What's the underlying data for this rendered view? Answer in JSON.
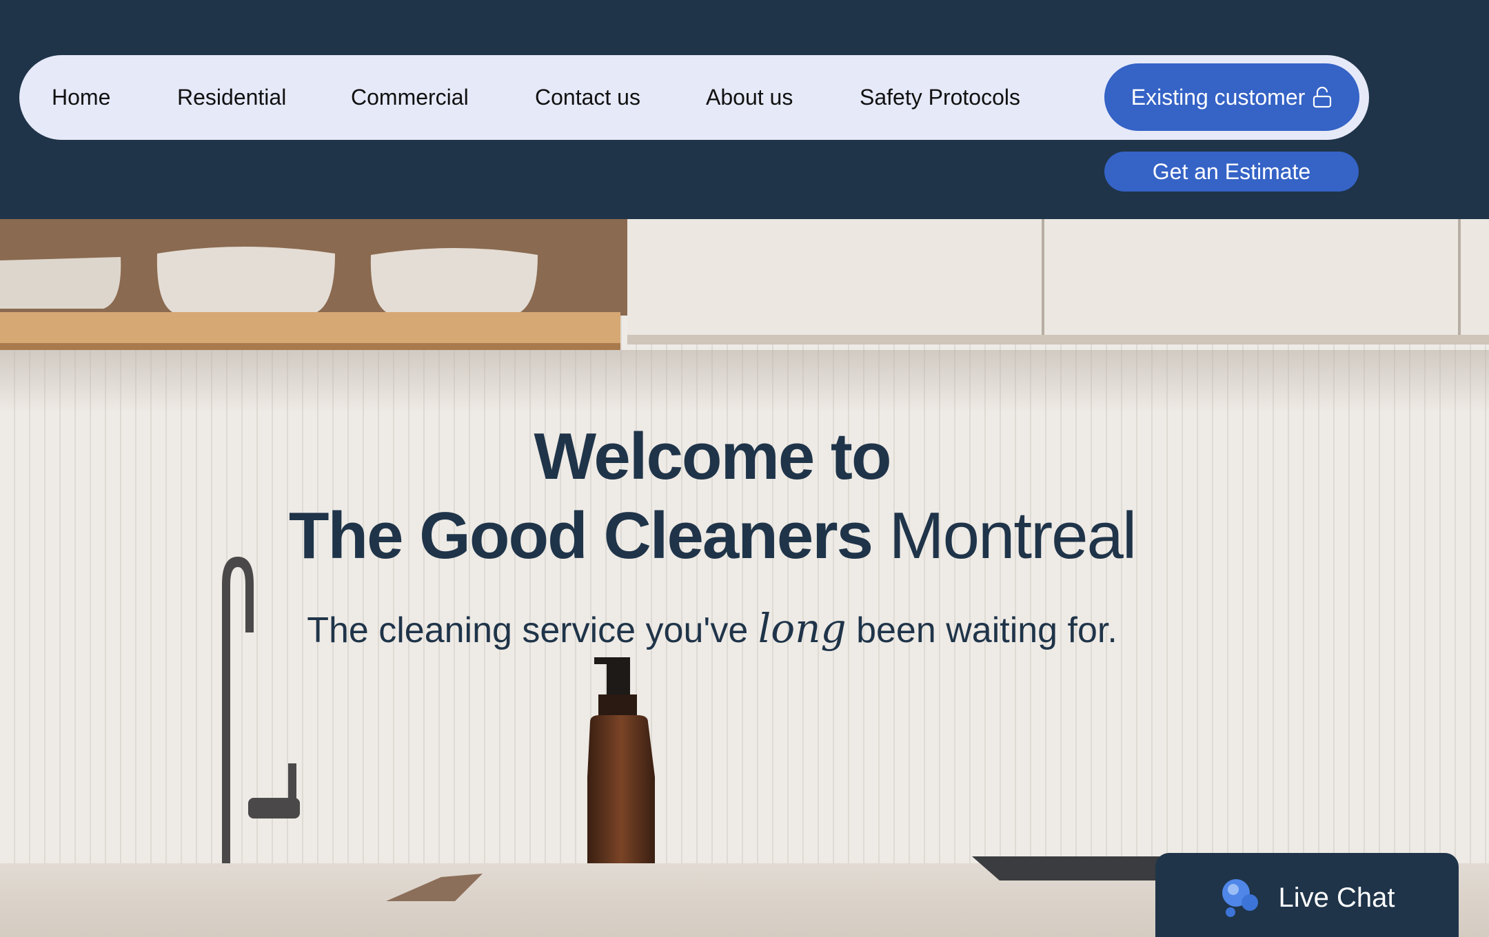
{
  "nav": {
    "items": [
      {
        "label": "Home"
      },
      {
        "label": "Residential"
      },
      {
        "label": "Commercial"
      },
      {
        "label": "Contact us"
      },
      {
        "label": "About us"
      },
      {
        "label": "Safety Protocols"
      }
    ],
    "existing_customer_label": "Existing customer",
    "estimate_label": "Get an Estimate"
  },
  "hero": {
    "title_line1": "Welcome to",
    "title_bold": "The Good Cleaners",
    "title_rest": " Montreal",
    "subtitle_pre": "The cleaning service you've ",
    "subtitle_em": "long",
    "subtitle_post": " been waiting for."
  },
  "live_chat": {
    "label": "Live Chat",
    "icon": "bubbles-icon"
  },
  "colors": {
    "header_bg": "#1f3449",
    "nav_bg": "#e6e9f8",
    "accent": "#3563c6",
    "text_dark": "#1f3449"
  }
}
